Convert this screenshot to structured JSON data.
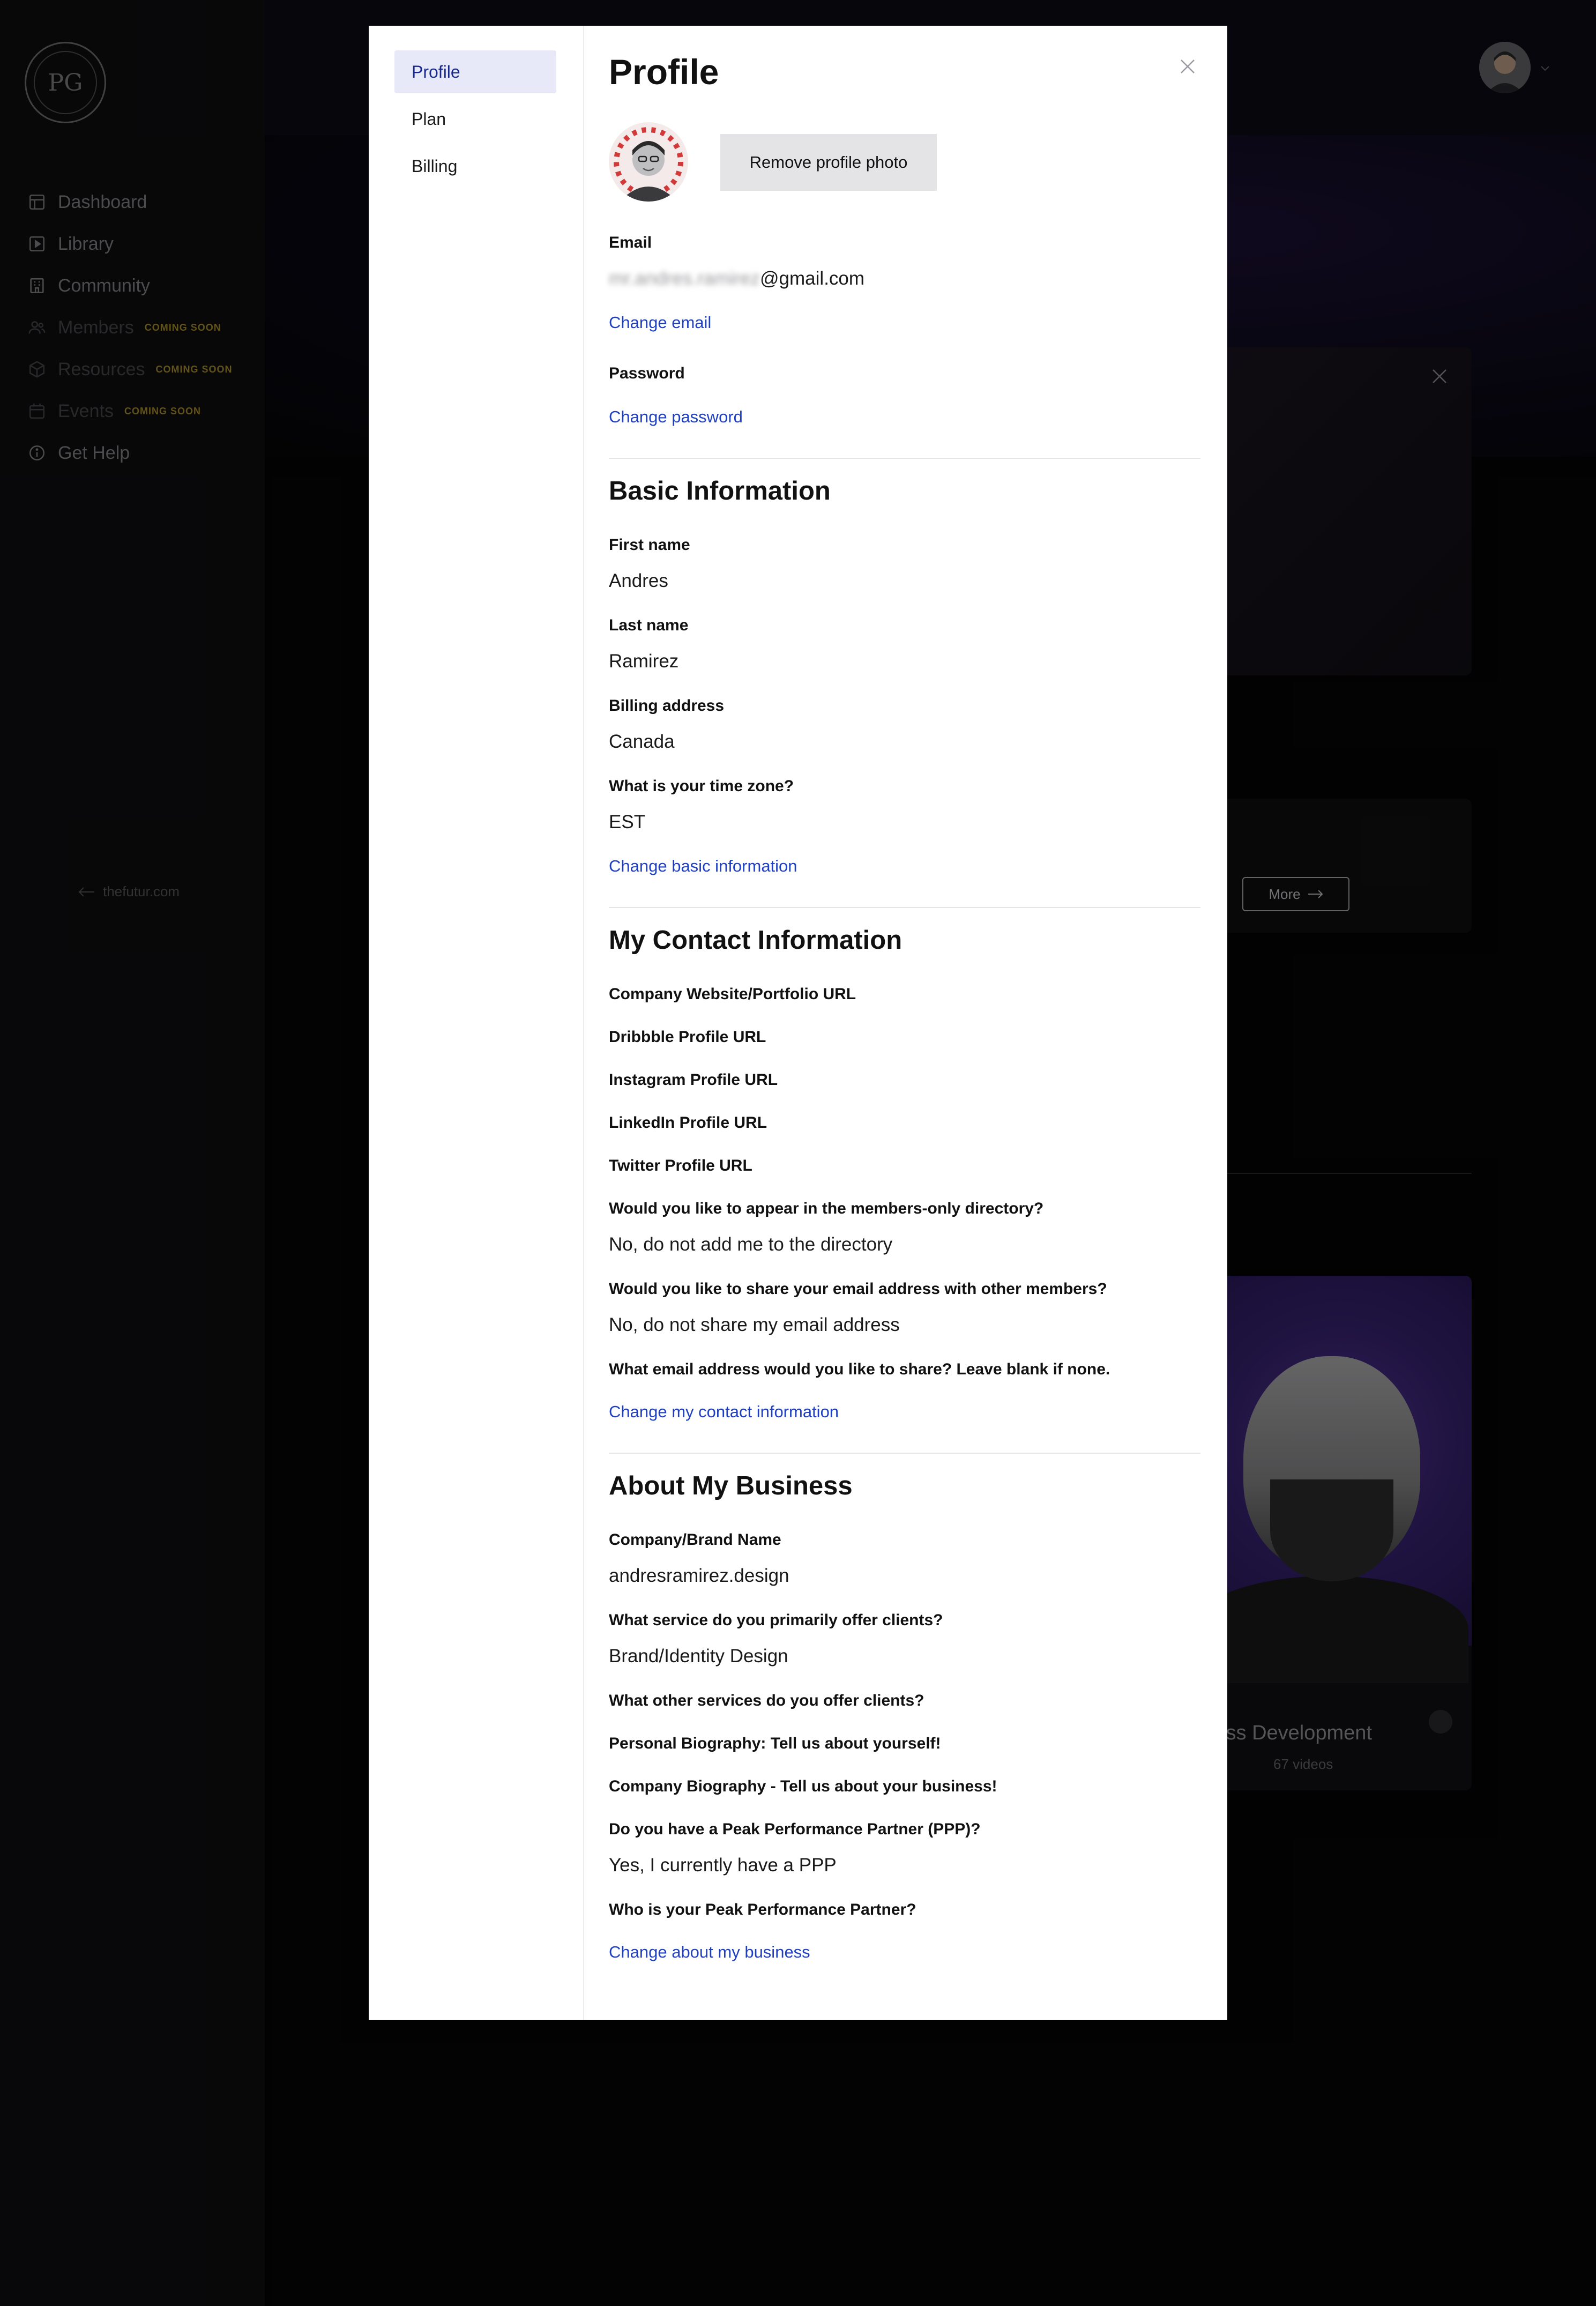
{
  "sidebar": {
    "logo_text": "PG",
    "nav": [
      {
        "label": "Dashboard",
        "icon": "dashboard-icon",
        "badge": ""
      },
      {
        "label": "Library",
        "icon": "library-icon",
        "badge": ""
      },
      {
        "label": "Community",
        "icon": "community-icon",
        "badge": ""
      },
      {
        "label": "Members",
        "icon": "members-icon",
        "badge": "COMING SOON"
      },
      {
        "label": "Resources",
        "icon": "resources-icon",
        "badge": "COMING SOON"
      },
      {
        "label": "Events",
        "icon": "events-icon",
        "badge": "COMING SOON"
      },
      {
        "label": "Get Help",
        "icon": "help-icon",
        "badge": ""
      }
    ],
    "back_link": "thefutur.com"
  },
  "background": {
    "more_button": "More",
    "course_title": "iness Development",
    "course_count": "67 videos"
  },
  "modal": {
    "tabs": [
      "Profile",
      "Plan",
      "Billing"
    ],
    "active_tab": "Profile",
    "title": "Profile",
    "remove_photo_label": "Remove profile photo",
    "email": {
      "label": "Email",
      "value_hidden": "mr.andres.ramirez",
      "value_domain": "@gmail.com",
      "change_link": "Change email"
    },
    "password": {
      "label": "Password",
      "change_link": "Change password"
    },
    "basic": {
      "heading": "Basic Information",
      "first_name_label": "First name",
      "first_name": "Andres",
      "last_name_label": "Last name",
      "last_name": "Ramirez",
      "billing_label": "Billing address",
      "billing": "Canada",
      "tz_label": "What is your time zone?",
      "tz": "EST",
      "change_link": "Change basic information"
    },
    "contact": {
      "heading": "My Contact Information",
      "website_label": "Company Website/Portfolio URL",
      "dribbble_label": "Dribbble Profile URL",
      "instagram_label": "Instagram Profile URL",
      "linkedin_label": "LinkedIn Profile URL",
      "twitter_label": "Twitter Profile URL",
      "directory_label": "Would you like to appear in the members-only directory?",
      "directory": "No, do not add me to the directory",
      "share_label": "Would you like to share your email address with other members?",
      "share": "No, do not share my email address",
      "share_email_label": "What email address would you like to share? Leave blank if none.",
      "change_link": "Change my contact information"
    },
    "business": {
      "heading": "About My Business",
      "company_label": "Company/Brand Name",
      "company": "andresramirez.design",
      "service_label": "What service do you primarily offer clients?",
      "service": "Brand/Identity Design",
      "other_label": "What other services do you offer clients?",
      "bio_label": "Personal Biography: Tell us about yourself!",
      "company_bio_label": "Company Biography - Tell us about your business!",
      "ppp_label": "Do you have a Peak Performance Partner (PPP)?",
      "ppp": "Yes, I currently have a PPP",
      "partner_label": "Who is your Peak Performance Partner?",
      "change_link": "Change about my business"
    }
  }
}
